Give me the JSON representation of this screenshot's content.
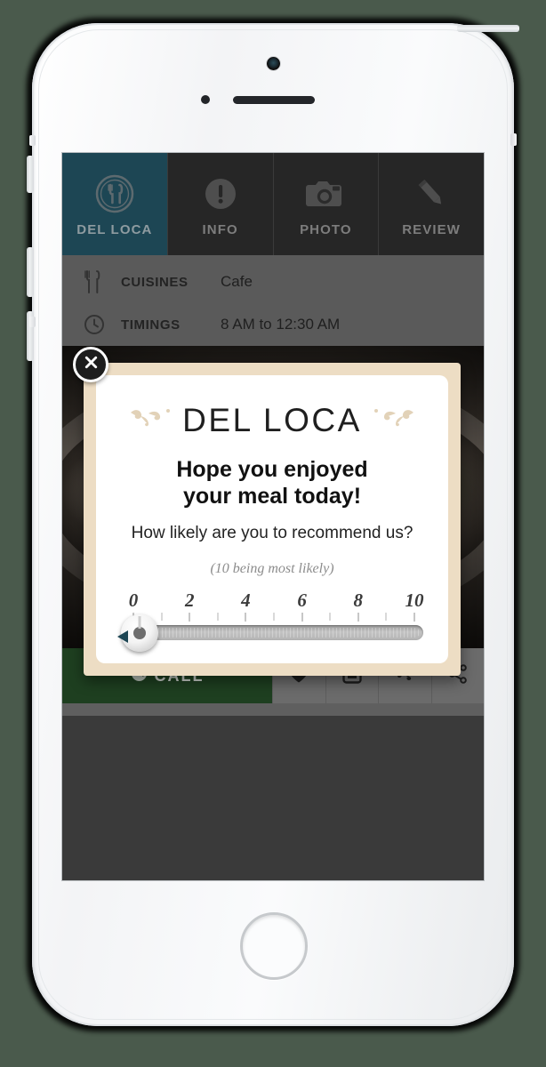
{
  "device": {
    "name": "white-smartphone",
    "camera": "camera-lens",
    "speaker": "earpiece-speaker",
    "sensor": "proximity-sensor",
    "home_button": "home-button"
  },
  "app": {
    "tabs": [
      {
        "label": "DEL LOCA",
        "icon": "restaurant-logo-icon",
        "active": true
      },
      {
        "label": "INFO",
        "icon": "info-exclamation-icon",
        "active": false
      },
      {
        "label": "PHOTO",
        "icon": "camera-icon",
        "active": false
      },
      {
        "label": "REVIEW",
        "icon": "pencil-icon",
        "active": false
      }
    ],
    "info_rows": [
      {
        "icon": "fork-knife-icon",
        "label": "CUISINES",
        "value": "Cafe"
      },
      {
        "icon": "clock-icon",
        "label": "TIMINGS",
        "value": "8 AM to 12:30 AM"
      }
    ],
    "action_bar": {
      "call_label": "CALL",
      "call_icon": "phone-icon",
      "buttons": [
        {
          "icon": "heart-icon",
          "name": "favorite-button"
        },
        {
          "icon": "bookmark-square-icon",
          "name": "bookmark-button"
        },
        {
          "icon": "footsteps-icon",
          "name": "check-in-button"
        },
        {
          "icon": "share-icon",
          "name": "share-button"
        }
      ]
    }
  },
  "modal": {
    "close_icon": "close-x-icon",
    "brand": "DEL LOCA",
    "flourish_left": "flourish-ornament-left",
    "flourish_right": "flourish-ornament-right",
    "headline_line1": "Hope you enjoyed",
    "headline_line2": "your meal today!",
    "question": "How likely are you to recommend us?",
    "hint": "(10 being most likely)",
    "slider": {
      "min": 0,
      "max": 10,
      "value": 0,
      "labels": [
        "0",
        "2",
        "4",
        "6",
        "8",
        "10"
      ],
      "label_values": [
        0,
        2,
        4,
        6,
        8,
        10
      ],
      "tick_values": [
        0,
        1,
        2,
        3,
        4,
        5,
        6,
        7,
        8,
        9,
        10
      ]
    }
  },
  "colors": {
    "page_background": "#4a5a4c",
    "tab_active": "#1d4654",
    "tab_inactive": "#262626",
    "info_background": "#5a5a5a",
    "modal_frame": "#edddc4",
    "modal_panel": "#ffffff",
    "call_button": "#1e3f20",
    "action_bar": "#6b6b6b",
    "hint_text": "#8c8c8c",
    "knob_arrow": "#1d4654"
  }
}
